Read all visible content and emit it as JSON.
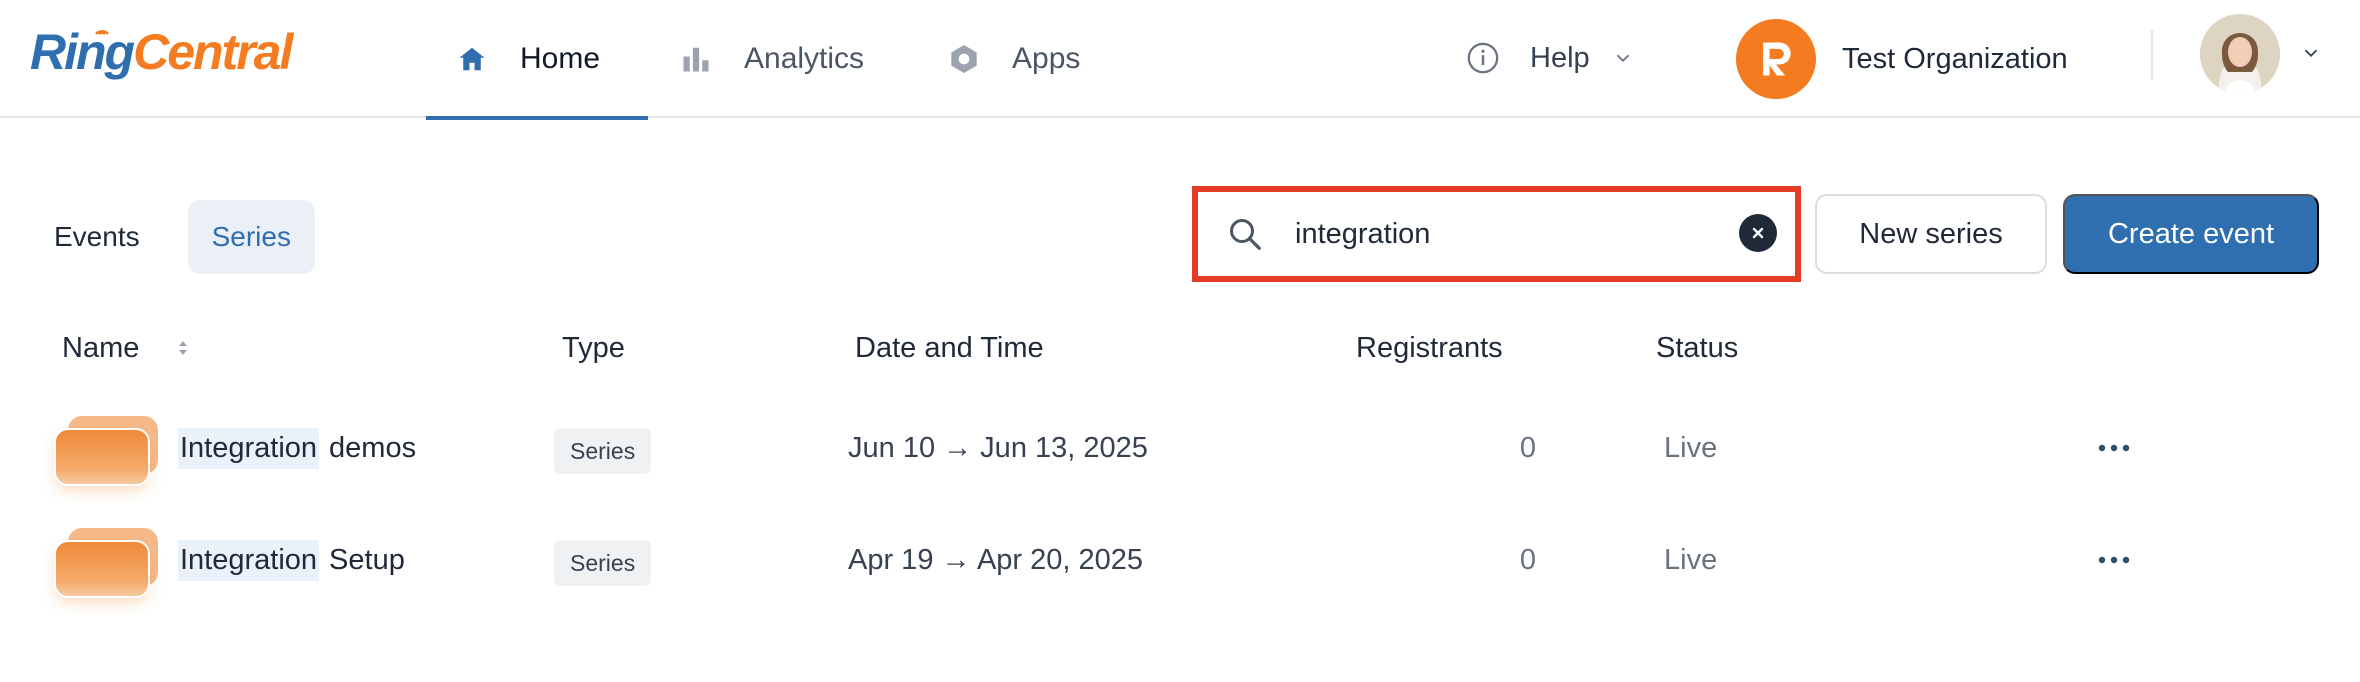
{
  "app": {
    "logo_ring": "Ring",
    "logo_central": "Central"
  },
  "nav": {
    "items": [
      {
        "label": "Home",
        "icon": "home-icon",
        "active": true
      },
      {
        "label": "Analytics",
        "icon": "bar-chart-icon",
        "active": false
      },
      {
        "label": "Apps",
        "icon": "hexagon-icon",
        "active": false
      }
    ]
  },
  "header": {
    "help_label": "Help",
    "org_name": "Test Organization"
  },
  "toolbar": {
    "view_tabs": [
      {
        "label": "Events",
        "active": false
      },
      {
        "label": "Series",
        "active": true
      }
    ],
    "search_value": "integration",
    "new_series_label": "New series",
    "create_event_label": "Create event"
  },
  "table": {
    "columns": [
      "Name",
      "Type",
      "Date and Time",
      "Registrants",
      "Status"
    ],
    "rows": [
      {
        "name_match": "Integration",
        "name_rest": "demos",
        "type": "Series",
        "date": "Jun 10 → Jun 13, 2025",
        "registrants": "0",
        "status": "Live"
      },
      {
        "name_match": "Integration",
        "name_rest": "Setup",
        "type": "Series",
        "date": "Apr 19 → Apr 20, 2025",
        "registrants": "0",
        "status": "Live"
      }
    ]
  },
  "colors": {
    "brand_blue": "#2f6fb0",
    "brand_orange": "#f47b20",
    "highlight_border": "#e63b26"
  }
}
